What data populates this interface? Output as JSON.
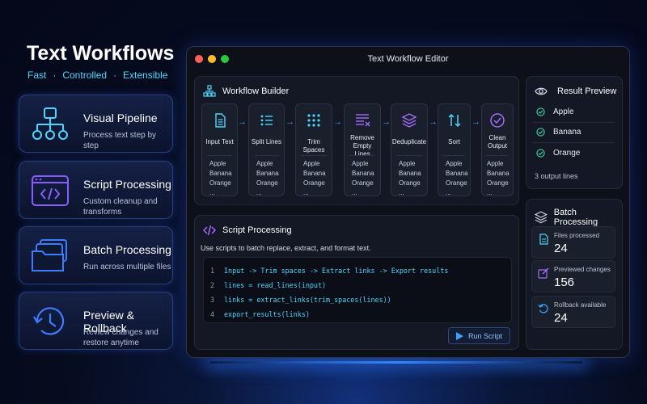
{
  "hero": {
    "title": "Text Workflows",
    "tags": [
      "Fast",
      "Controlled",
      "Extensible"
    ]
  },
  "features": [
    {
      "title": "Visual Pipeline",
      "desc": "Process text step by step",
      "icon": "hierarchy-icon"
    },
    {
      "title": "Script Processing",
      "desc": "Custom cleanup and transforms",
      "icon": "code-window-icon"
    },
    {
      "title": "Batch Processing",
      "desc": "Run across multiple files",
      "icon": "folders-icon"
    },
    {
      "title": "Preview & Rollback",
      "desc": "Review changes and restore anytime",
      "icon": "history-icon"
    }
  ],
  "window": {
    "title": "Text Workflow Editor",
    "traffic_colors": [
      "#ff5f56",
      "#ffbd2e",
      "#27c93f"
    ]
  },
  "workflow": {
    "heading": "Workflow Builder",
    "steps": [
      {
        "label": "Input Text",
        "icon": "document-icon",
        "items": [
          "Apple",
          "Banana",
          "Orange",
          "..."
        ]
      },
      {
        "label": "Split Lines",
        "icon": "list-icon",
        "items": [
          "Apple",
          "Banana",
          "Orange",
          "..."
        ]
      },
      {
        "label": "Trim Spaces",
        "icon": "dots-grid-icon",
        "items": [
          "Apple",
          "Banana",
          "Orange",
          "..."
        ]
      },
      {
        "label": "Remove Empty Lines",
        "icon": "lines-remove-icon",
        "items": [
          "Apple",
          "Banana",
          "Orange",
          "..."
        ]
      },
      {
        "label": "Deduplicate",
        "icon": "layers-icon",
        "items": [
          "Apple",
          "Banana",
          "Orange",
          "..."
        ]
      },
      {
        "label": "Sort",
        "icon": "sort-arrows-icon",
        "items": [
          "Apple",
          "Banana",
          "Orange",
          "..."
        ]
      },
      {
        "label": "Clean Output",
        "icon": "check-circle-icon",
        "items": [
          "Apple",
          "Banana",
          "Orange",
          "..."
        ]
      }
    ]
  },
  "script": {
    "heading": "Script Processing",
    "description": "Use scripts to batch replace, extract, and format text.",
    "lines": [
      {
        "n": "1",
        "text": "Input -> Trim spaces -> Extract links -> Export results"
      },
      {
        "n": "2",
        "text": "lines = read_lines(input)"
      },
      {
        "n": "3",
        "text": "links = extract_links(trim_spaces(lines))"
      },
      {
        "n": "4",
        "text": "export_results(links)"
      }
    ],
    "run_label": "Run Script"
  },
  "preview": {
    "heading": "Result Preview",
    "results": [
      "Apple",
      "Banana",
      "Orange"
    ],
    "count_text": "3 output lines"
  },
  "batch": {
    "heading": "Batch Processing",
    "stats": [
      {
        "label": "Files processed",
        "value": "24",
        "icon": "file-icon",
        "color": "#4fd6ff"
      },
      {
        "label": "Previewed changes",
        "value": "156",
        "icon": "edit-icon",
        "color": "#a66bff"
      },
      {
        "label": "Rollback available",
        "value": "24",
        "icon": "undo-icon",
        "color": "#3ea0ff"
      }
    ]
  },
  "colors": {
    "accent_cyan": "#4fd6ff",
    "accent_blue": "#3ea0ff",
    "accent_purple": "#a66bff",
    "success_teal": "#3ccf9e"
  }
}
